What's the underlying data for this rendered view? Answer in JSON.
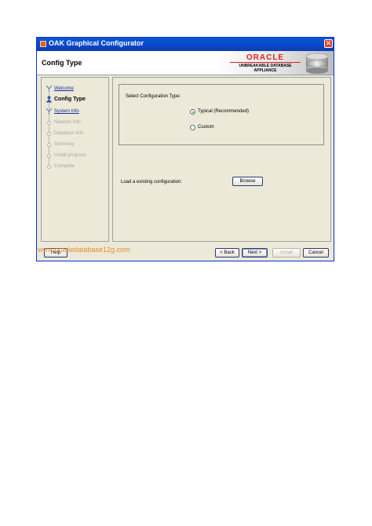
{
  "window": {
    "title": "OAK Graphical Configurator",
    "close_glyph": "✕"
  },
  "header": {
    "title": "Config Type",
    "logo_text": "ORACLE",
    "logo_sub1": "UNBREAKABLE DATABASE",
    "logo_sub2": "APPLIANCE"
  },
  "nav": {
    "items": [
      {
        "label": "Welcome",
        "state": "link"
      },
      {
        "label": "Config Type",
        "state": "current"
      },
      {
        "label": "System Info",
        "state": "link"
      },
      {
        "label": "Network Info",
        "state": "disabled"
      },
      {
        "label": "Database Info",
        "state": "disabled"
      },
      {
        "label": "Summary",
        "state": "disabled"
      },
      {
        "label": "Install progress",
        "state": "disabled"
      },
      {
        "label": "Complete",
        "state": "disabled"
      }
    ]
  },
  "main": {
    "select_label": "Select Configuration Type:",
    "options": [
      {
        "label": "Typical (Recommended)",
        "checked": true
      },
      {
        "label": "Custom",
        "checked": false
      }
    ],
    "load_label": "Load a existing configuration:",
    "browse_label": "Browse"
  },
  "footer": {
    "help_label": "Help",
    "back_label": "< Back",
    "next_label": "Next >",
    "install_label": "Install",
    "cancel_label": "Cancel"
  },
  "watermark": "www.oracledatabase12g.com",
  "colors": {
    "titlebar": "#0846c8",
    "oracle_red": "#e21f1f",
    "window_bg": "#ece9d8",
    "watermark": "#e78a2a"
  }
}
